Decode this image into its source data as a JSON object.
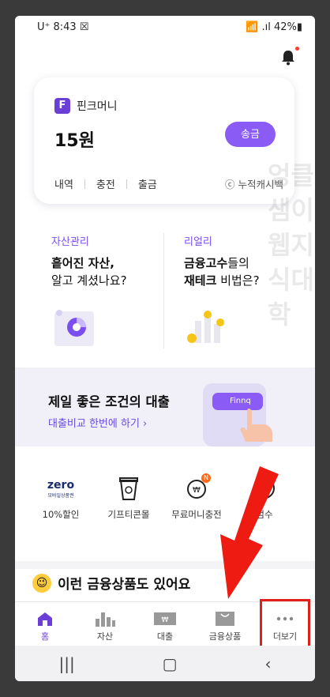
{
  "status": {
    "left": "U⁺ 8:43 ☒",
    "right": "📶 .ıl 42%▮"
  },
  "card": {
    "brand_letter": "F",
    "brand_name": "핀크머니",
    "amount": "15원",
    "send": "송금",
    "nav": [
      "내역",
      "충전",
      "출금"
    ],
    "cash": "ⓒ 누적캐시백"
  },
  "promo": [
    {
      "tag": "자산관리",
      "line1_bold": "흩어진 자산,",
      "line2": "알고 계셨나요?"
    },
    {
      "tag": "리얼리",
      "line1_bold": "금융고수",
      "line1_rest": "들의",
      "line2_bold": "재테크",
      "line2_rest": " 비법은?"
    }
  ],
  "loan": {
    "title": "제일 좋은 조건의 대출",
    "link": "대출비교 한번에 하기 ›",
    "badge": "Finnq"
  },
  "quick": [
    {
      "label": "10%할인",
      "icon": "zero-pay-icon",
      "logo": "zero",
      "sub": "모바일상품권"
    },
    {
      "label": "기프티콘몰",
      "icon": "gift-cup-icon"
    },
    {
      "label": "무료머니충전",
      "icon": "free-money-icon",
      "badge": "N"
    },
    {
      "label": "점수",
      "icon": "credit-score-icon"
    }
  ],
  "suggest": {
    "emoji": "😉",
    "text": "이런 금융상품도 있어요"
  },
  "tabs": [
    {
      "label": "홈",
      "icon": "home-icon",
      "active": true
    },
    {
      "label": "자산",
      "icon": "chart-icon"
    },
    {
      "label": "대출",
      "icon": "loan-icon"
    },
    {
      "label": "금융상품",
      "icon": "bag-icon"
    },
    {
      "label": "더보기",
      "icon": "more-icon"
    }
  ],
  "sysnav": [
    "|||",
    "▢",
    "‹"
  ],
  "watermark": "엉클샘이웹지식대학",
  "colors": {
    "accent": "#6b3fd6",
    "button": "#8a5cf5",
    "highlight": "#e0201b"
  }
}
